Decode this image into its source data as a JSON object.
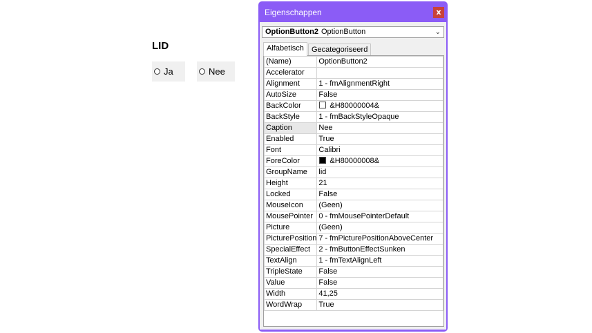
{
  "form": {
    "title": "LID",
    "options": [
      {
        "label": "Ja"
      },
      {
        "label": "Nee"
      }
    ]
  },
  "properties_window": {
    "title": "Eigenschappen",
    "close_label": "x",
    "object_selector": {
      "name": "OptionButton2",
      "type": "OptionButton"
    },
    "tabs": [
      {
        "label": "Alfabetisch",
        "active": true
      },
      {
        "label": "Gecategoriseerd",
        "active": false
      }
    ],
    "properties": [
      {
        "key": "(Name)",
        "value": "OptionButton2"
      },
      {
        "key": "Accelerator",
        "value": ""
      },
      {
        "key": "Alignment",
        "value": "1 - fmAlignmentRight"
      },
      {
        "key": "AutoSize",
        "value": "False"
      },
      {
        "key": "BackColor",
        "value": "&H80000004&",
        "swatch": "#ffffff"
      },
      {
        "key": "BackStyle",
        "value": "1 - fmBackStyleOpaque"
      },
      {
        "key": "Caption",
        "value": "Nee",
        "selected": true
      },
      {
        "key": "Enabled",
        "value": "True"
      },
      {
        "key": "Font",
        "value": "Calibri"
      },
      {
        "key": "ForeColor",
        "value": "&H80000008&",
        "swatch": "#000000"
      },
      {
        "key": "GroupName",
        "value": "lid"
      },
      {
        "key": "Height",
        "value": "21"
      },
      {
        "key": "Locked",
        "value": "False"
      },
      {
        "key": "MouseIcon",
        "value": "(Geen)"
      },
      {
        "key": "MousePointer",
        "value": "0 - fmMousePointerDefault"
      },
      {
        "key": "Picture",
        "value": "(Geen)"
      },
      {
        "key": "PicturePosition",
        "value": "7 - fmPicturePositionAboveCenter"
      },
      {
        "key": "SpecialEffect",
        "value": "2 - fmButtonEffectSunken"
      },
      {
        "key": "TextAlign",
        "value": "1 - fmTextAlignLeft"
      },
      {
        "key": "TripleState",
        "value": "False"
      },
      {
        "key": "Value",
        "value": "False"
      },
      {
        "key": "Width",
        "value": "41,25"
      },
      {
        "key": "WordWrap",
        "value": "True"
      }
    ],
    "colors": {
      "window_accent": "#8b5cf6",
      "close": "#c8423a"
    }
  }
}
